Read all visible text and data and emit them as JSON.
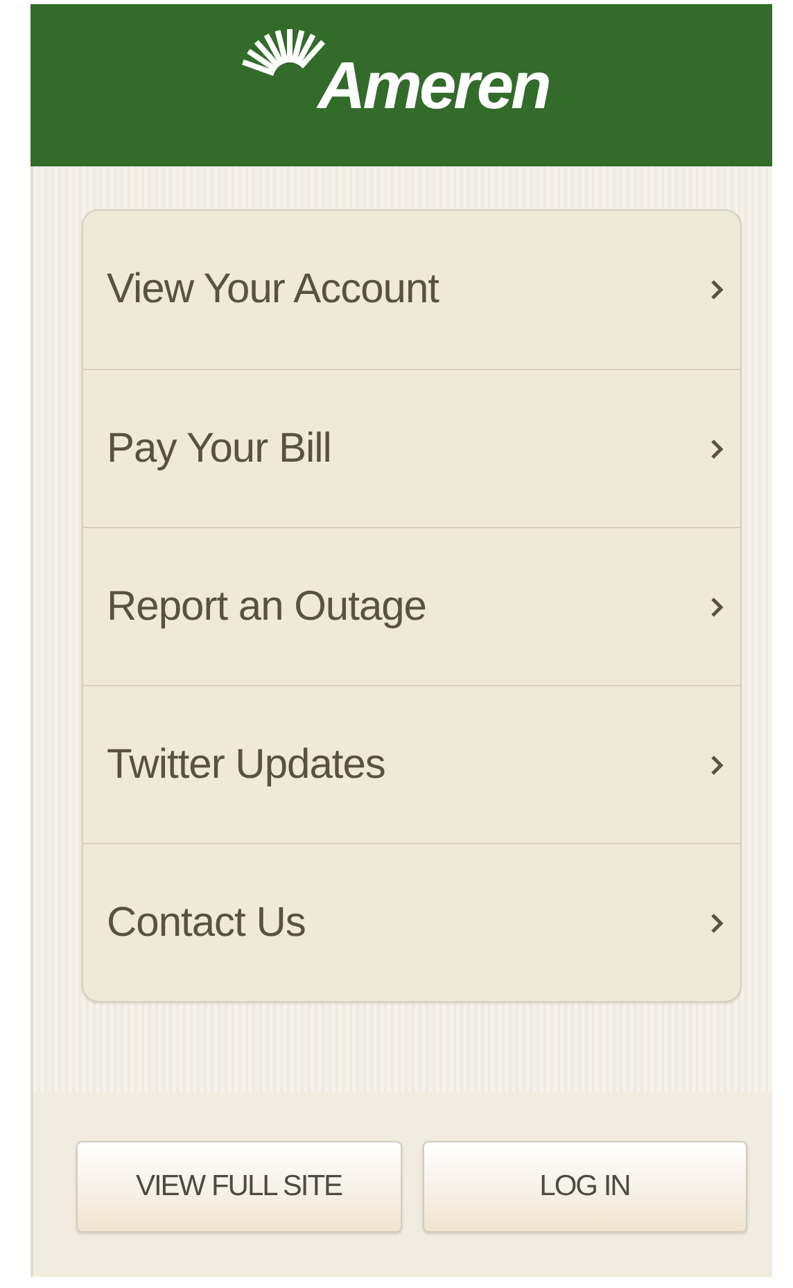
{
  "header": {
    "logo_text": "Ameren"
  },
  "menu": {
    "items": [
      {
        "label": "View Your Account"
      },
      {
        "label": "Pay Your Bill"
      },
      {
        "label": "Report an Outage"
      },
      {
        "label": "Twitter Updates"
      },
      {
        "label": "Contact Us"
      }
    ]
  },
  "footer": {
    "buttons": [
      "VIEW FULL SITE",
      "LOG IN"
    ]
  }
}
